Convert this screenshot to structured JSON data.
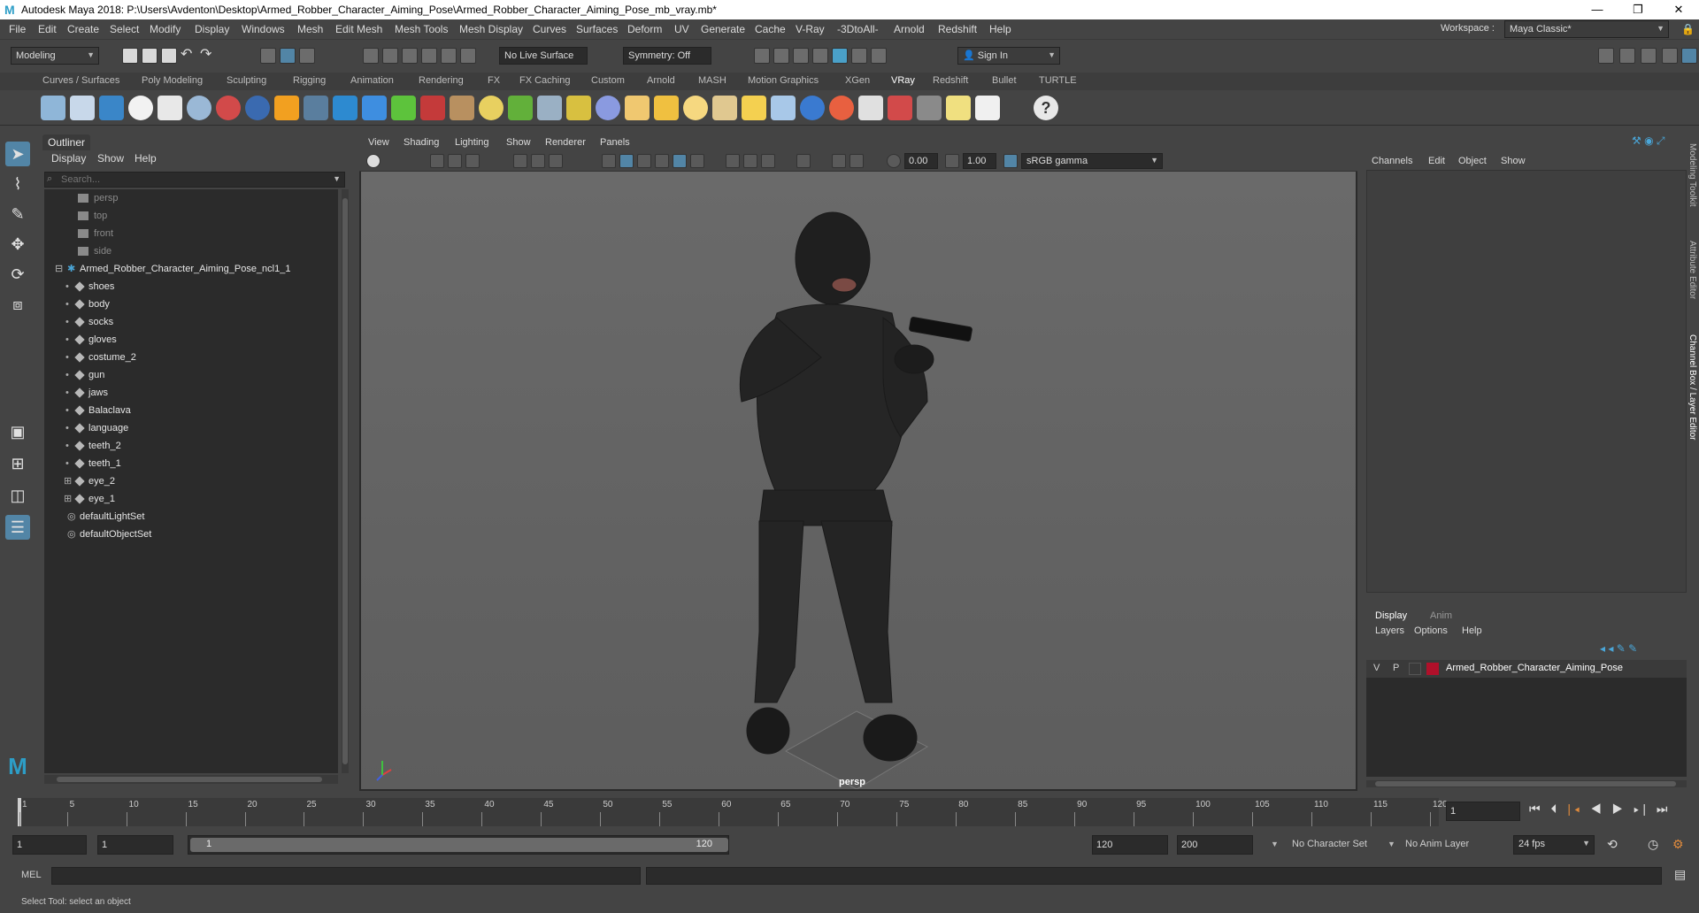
{
  "titlebar": {
    "title": "Autodesk Maya 2018: P:\\Users\\Avdenton\\Desktop\\Armed_Robber_Character_Aiming_Pose\\Armed_Robber_Character_Aiming_Pose_mb_vray.mb*",
    "logo": "M",
    "minimize": "—",
    "maximize": "❐",
    "close": "✕"
  },
  "menubar": {
    "items": [
      "File",
      "Edit",
      "Create",
      "Select",
      "Modify",
      "Display",
      "Windows",
      "Mesh",
      "Edit Mesh",
      "Mesh Tools",
      "Mesh Display",
      "Curves",
      "Surfaces",
      "Deform",
      "UV",
      "Generate",
      "Cache",
      "V-Ray",
      "-3DtoAll-",
      "Arnold",
      "Redshift",
      "Help"
    ],
    "workspace_label": "Workspace :",
    "workspace_value": "Maya Classic*"
  },
  "statusline": {
    "mode": "Modeling",
    "live_surface": "No Live Surface",
    "symmetry": "Symmetry: Off",
    "sign_in": "Sign In"
  },
  "shelf": {
    "tabs": [
      "Curves / Surfaces",
      "Poly Modeling",
      "Sculpting",
      "Rigging",
      "Animation",
      "Rendering",
      "FX",
      "FX Caching",
      "Custom",
      "Arnold",
      "MASH",
      "Motion Graphics",
      "XGen",
      "VRay",
      "Redshift",
      "Bullet",
      "TURTLE"
    ],
    "active_tab": "VRay"
  },
  "outliner": {
    "title": "Outliner",
    "menu": [
      "Display",
      "Show",
      "Help"
    ],
    "search_placeholder": "Search...",
    "cameras": [
      "persp",
      "top",
      "front",
      "side"
    ],
    "root": "Armed_Robber_Character_Aiming_Pose_ncl1_1",
    "children": [
      "shoes",
      "body",
      "socks",
      "gloves",
      "costume_2",
      "gun",
      "jaws",
      "Balaclava",
      "language",
      "teeth_2",
      "teeth_1",
      "eye_2",
      "eye_1"
    ],
    "sets": [
      "defaultLightSet",
      "defaultObjectSet"
    ]
  },
  "viewport": {
    "menu": [
      "View",
      "Shading",
      "Lighting",
      "Show",
      "Renderer",
      "Panels"
    ],
    "exposure": "0.00",
    "gamma": "1.00",
    "colorspace": "sRGB gamma",
    "camera_label": "persp"
  },
  "channelbox": {
    "menu": [
      "Channels",
      "Edit",
      "Object",
      "Show"
    ],
    "vertical_tabs": [
      "Modeling Toolkit",
      "Attribute Editor",
      "Channel Box / Layer Editor"
    ]
  },
  "layereditor": {
    "tabs": [
      "Display",
      "Anim"
    ],
    "active_tab": "Display",
    "menu": [
      "Layers",
      "Options",
      "Help"
    ],
    "layer": {
      "v": "V",
      "p": "P",
      "name": "Armed_Robber_Character_Aiming_Pose",
      "color": "#b0102a"
    }
  },
  "timeslider": {
    "ticks": [
      "1",
      "5",
      "10",
      "15",
      "20",
      "25",
      "30",
      "35",
      "40",
      "45",
      "50",
      "55",
      "60",
      "65",
      "70",
      "75",
      "80",
      "85",
      "90",
      "95",
      "100",
      "105",
      "110",
      "115",
      "120"
    ],
    "current_frame": "1"
  },
  "rangeslider": {
    "start": "1",
    "playback_start": "1",
    "range_start": "1",
    "range_end": "120",
    "playback_end": "120",
    "end": "200",
    "character_set": "No Character Set",
    "anim_layer": "No Anim Layer",
    "fps": "24 fps"
  },
  "cmdline": {
    "label": "MEL"
  },
  "helpline": {
    "text": "Select Tool: select an object"
  }
}
